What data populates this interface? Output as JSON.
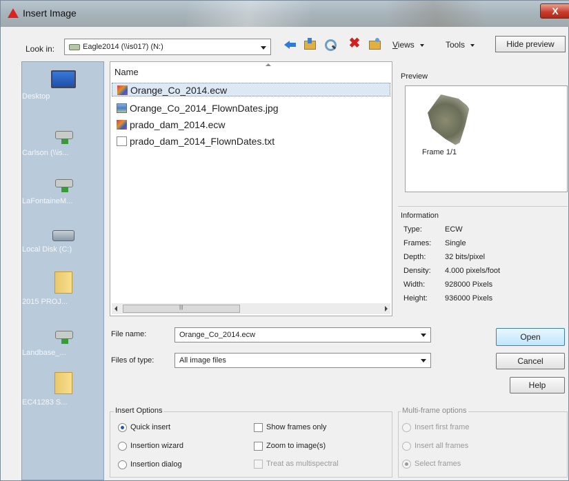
{
  "window": {
    "title": "Insert Image",
    "close_label": "X"
  },
  "toolbar": {
    "lookin_label": "Look in:",
    "lookin_value": "Eagle2014 (\\\\is017) (N:)",
    "views_label": "Views",
    "views_accel": "V",
    "views_rest": "iews",
    "tools_label": "Tools",
    "hide_preview_label": "Hide preview"
  },
  "places": [
    {
      "label": "Desktop",
      "icon": "desktop-icon"
    },
    {
      "label": "Carlson (\\\\is...",
      "icon": "network-drive-icon"
    },
    {
      "label": "LaFontaineM...",
      "icon": "network-drive-icon"
    },
    {
      "label": "Local Disk (C:)",
      "icon": "local-disk-icon"
    },
    {
      "label": "2015 PROJ...",
      "icon": "folder-icon"
    },
    {
      "label": "Landbase_...",
      "icon": "network-drive-icon"
    },
    {
      "label": "EC41283 S...",
      "icon": "folder-icon"
    }
  ],
  "filelist": {
    "column_name": "Name",
    "files": [
      {
        "name": "Orange_Co_2014.ecw",
        "type": "ecw",
        "selected": true
      },
      {
        "name": "Orange_Co_2014_FlownDates.jpg",
        "type": "jpg",
        "selected": false
      },
      {
        "name": "prado_dam_2014.ecw",
        "type": "ecw",
        "selected": false
      },
      {
        "name": "prado_dam_2014_FlownDates.txt",
        "type": "txt",
        "selected": false
      }
    ]
  },
  "preview": {
    "label": "Preview",
    "frame": "Frame 1/1"
  },
  "information": {
    "heading": "Information",
    "rows": [
      {
        "key": "Type:",
        "value": "ECW"
      },
      {
        "key": "Frames:",
        "value": "Single"
      },
      {
        "key": "Depth:",
        "value": "32 bits/pixel"
      },
      {
        "key": "Density:",
        "value": "4.000 pixels/foot"
      },
      {
        "key": "Width:",
        "value": "928000 Pixels"
      },
      {
        "key": "Height:",
        "value": "936000 Pixels"
      }
    ]
  },
  "form": {
    "filename_label": "File name:",
    "filename_value": "Orange_Co_2014.ecw",
    "filetype_label": "Files of type:",
    "filetype_value": "All image files"
  },
  "buttons": {
    "open": "Open",
    "cancel": "Cancel",
    "help": "Help"
  },
  "insert_options": {
    "title": "Insert Options",
    "radios": [
      {
        "label": "Quick insert",
        "checked": true
      },
      {
        "label": "Insertion wizard",
        "checked": false
      },
      {
        "label": "Insertion dialog",
        "checked": false
      }
    ],
    "checks": [
      {
        "label": "Show frames only",
        "checked": false,
        "disabled": false
      },
      {
        "label": "Zoom to image(s)",
        "checked": false,
        "disabled": false
      },
      {
        "label": "Treat as multispectral",
        "checked": false,
        "disabled": true
      }
    ]
  },
  "multiframe_options": {
    "title": "Multi-frame options",
    "radios": [
      {
        "label": "Insert first frame",
        "checked": false
      },
      {
        "label": "Insert all frames",
        "checked": false
      },
      {
        "label": "Select frames",
        "checked": true
      }
    ]
  },
  "colors": {
    "selection": "#dce8f4",
    "places_bg": "#b9cadb",
    "default_button": "#bee6fd"
  }
}
